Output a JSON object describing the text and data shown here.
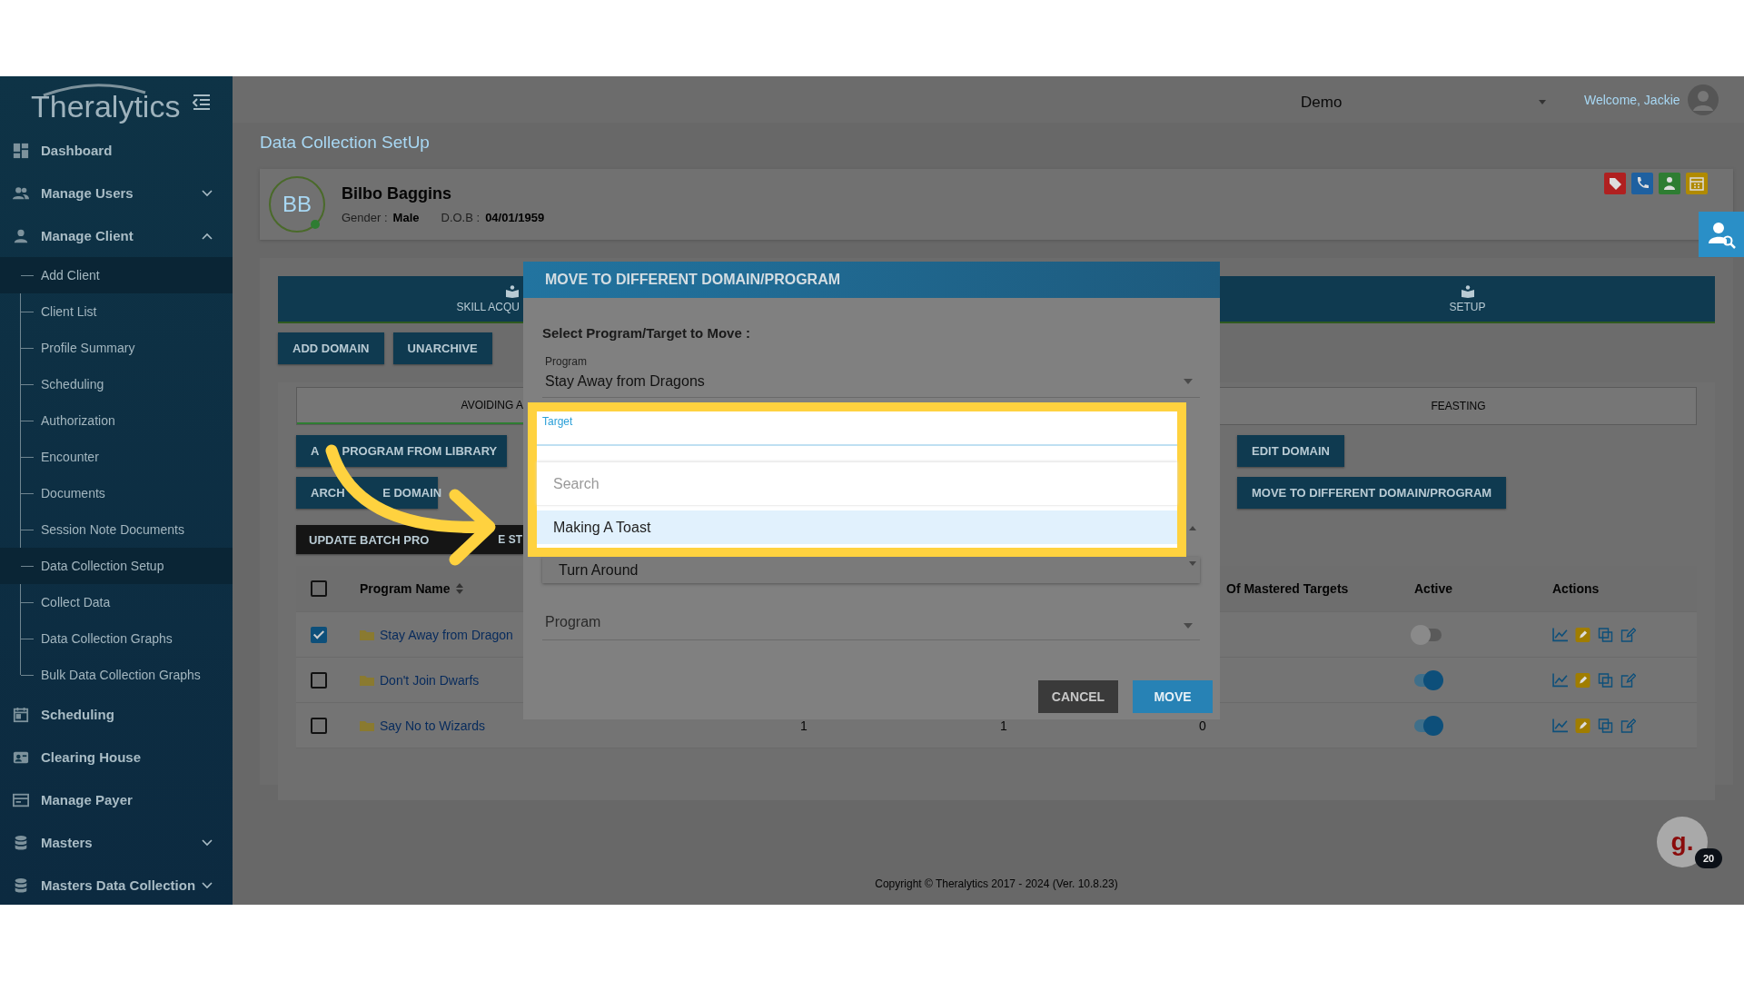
{
  "sidebar": {
    "logo": "Thera**lytics**",
    "items": [
      {
        "kind": "link",
        "label": "Dashboard"
      },
      {
        "kind": "group",
        "label": "Manage Users",
        "expanded": false
      },
      {
        "kind": "group",
        "label": "Manage Client",
        "expanded": true,
        "children": [
          {
            "label": "Add Client",
            "selected": true
          },
          {
            "label": "Client List",
            "selected": false
          },
          {
            "label": "Profile Summary",
            "selected": false
          },
          {
            "label": "Scheduling",
            "selected": false
          },
          {
            "label": "Authorization",
            "selected": false
          },
          {
            "label": "Encounter",
            "selected": false
          },
          {
            "label": "Documents",
            "selected": false
          },
          {
            "label": "Session Note Documents",
            "selected": false
          },
          {
            "label": "Data Collection Setup",
            "selected": true
          },
          {
            "label": "Collect Data",
            "selected": false
          },
          {
            "label": "Data Collection Graphs",
            "selected": false
          },
          {
            "label": "Bulk Data Collection Graphs",
            "selected": false
          }
        ]
      },
      {
        "kind": "link",
        "label": "Scheduling"
      },
      {
        "kind": "link",
        "label": "Clearing House"
      },
      {
        "kind": "link",
        "label": "Manage Payer"
      },
      {
        "kind": "group",
        "label": "Masters",
        "expanded": false
      },
      {
        "kind": "group",
        "label": "Masters Data Collection",
        "expanded": false
      }
    ]
  },
  "top_bar": {
    "organization": "Demo",
    "welcome": "Welcome, Jackie"
  },
  "page_title": "Data Collection SetUp",
  "client": {
    "initials": "BB",
    "online": true,
    "name": "Bilbo Baggins",
    "gender_label": "Gender :",
    "gender": "Male",
    "dob_label": "D.O.B :",
    "dob": "04/01/1959",
    "quick_actions": [
      {
        "color": "#b02020"
      },
      {
        "color": "#1e60a0"
      },
      {
        "color": "#2e7d32"
      },
      {
        "color": "#b08a00"
      }
    ]
  },
  "tabs": [
    {
      "label": "SKILL ACQU"
    },
    {
      "label": "SETUP"
    }
  ],
  "domain_buttons": [
    "ADD DOMAIN",
    "UNARCHIVE"
  ],
  "domains": [
    {
      "label": "AVOIDING A",
      "selected": true
    },
    {
      "label": "FEASTING",
      "selected": false
    }
  ],
  "left_actions": [
    [
      "A",
      "PROGRAM FROM LIBRARY"
    ],
    [
      "ARCH",
      "E DOMAIN"
    ]
  ],
  "batch_button": [
    "UPDATE BATCH PRO",
    "E ST"
  ],
  "right_actions": [
    "EDIT DOMAIN",
    "MOVE TO DIFFERENT DOMAIN/PROGRAM"
  ],
  "table": {
    "header_checked": false,
    "name_column": "Program Name",
    "mastered_column": "Of Mastered Targets",
    "active_column": "Active",
    "actions_column": "Actions",
    "rows": [
      {
        "checked": true,
        "name": "Stay Away from Dragon",
        "active": false
      },
      {
        "checked": false,
        "name": "Don't Join Dwarfs",
        "active": true
      },
      {
        "checked": false,
        "name": "Say No to Wizards",
        "active": true,
        "counts": [
          "1",
          "1",
          "0"
        ]
      }
    ]
  },
  "footer": "Copyright © Theralytics 2017 - 2024 (Ver. 10.8.23)",
  "help": {
    "label": "g.",
    "badge": "20"
  },
  "modal": {
    "title": "MOVE TO DIFFERENT DOMAIN/PROGRAM",
    "prompt": "Select Program/Target to Move :",
    "program_field": {
      "label": "Program",
      "value": "Stay Away from Dragons"
    },
    "target_field": {
      "label": "Target",
      "focused": true
    },
    "search": {
      "placeholder": "Search"
    },
    "options": [
      {
        "label": "Making A Toast",
        "selected": true
      },
      {
        "label": "Turn Around",
        "selected": false
      }
    ],
    "second_field": {
      "placeholder": "Program"
    },
    "cancel": "CANCEL",
    "move": "MOVE"
  }
}
